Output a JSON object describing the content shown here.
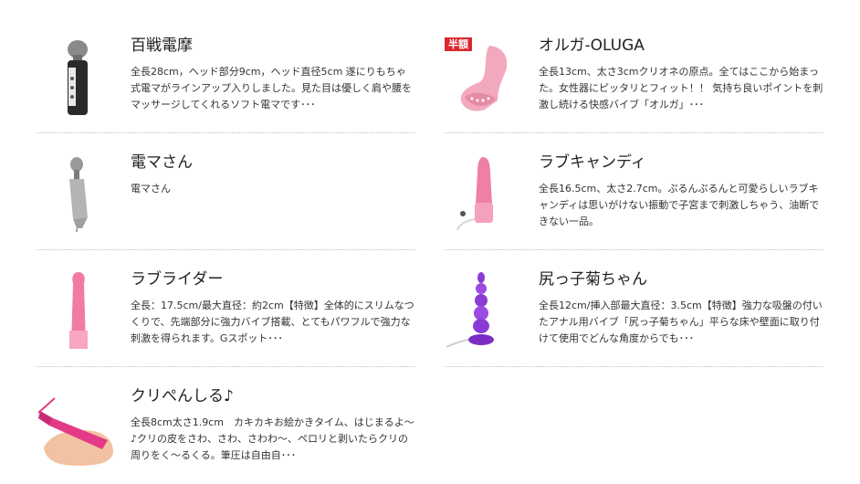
{
  "products": [
    {
      "title": "百戦電摩",
      "description": "全長28cm，ヘッド部分9cm，ヘッド直径5cm 遂にりもちゃ式電マがラインアップ入りしました。見た目は優しく肩や腰をマッサージしてくれるソフト電マです･･･",
      "icon": "wand-massager-icon",
      "badge": ""
    },
    {
      "title": "オルガ-OLUGA",
      "description": "全長13cm、太さ3cmクリオネの原点。全てはここから始まった。女性器にピッタリとフィット！！ 気持ち良いポイントを刺激し続ける快感バイブ「オルガ」･･･",
      "icon": "pink-vibrator-icon",
      "badge": "半額"
    },
    {
      "title": "電マさん",
      "description": "電マさん",
      "icon": "handheld-massager-icon",
      "badge": ""
    },
    {
      "title": "ラブキャンディ",
      "description": "全長16.5cm、太さ2.7cm。ぷるんぷるんと可愛らしいラブキャンディは思いがけない振動で子宮まで刺激しちゃう、油断できない一品。",
      "icon": "pink-vibe-with-cord-icon",
      "badge": ""
    },
    {
      "title": "ラブライダー",
      "description": "全長：17.5cm/最大直径：約2cm【特徴】全体的にスリムなつくりで、先端部分に強力バイブ搭載、とてもパワフルで強力な刺激を得られます。Gスポット･･･",
      "icon": "pink-dildo-icon",
      "badge": ""
    },
    {
      "title": "尻っ子菊ちゃん",
      "description": "全長12cm/挿入部最大直径：3.5cm【特徴】強力な吸盤の付いたアナル用バイブ「尻っ子菊ちゃん」平らな床や壁面に取り付けて使用でどんな角度からでも･･･",
      "icon": "purple-beaded-vibe-icon",
      "badge": ""
    },
    {
      "title": "クリぺんしる♪",
      "description": "全長8cm太さ1.9cm　カキカキお絵かきタイム、はじまるよ～♪クリの皮をさわ、さわ、さわわ～、ペロリと剥いたらクリの周りをく～るくる。筆圧は自由自･･･",
      "icon": "pen-vibrator-in-hand-icon",
      "badge": ""
    }
  ],
  "colors": {
    "badge": "#d9282e",
    "divider": "#bdbdbd",
    "text": "#333333"
  }
}
